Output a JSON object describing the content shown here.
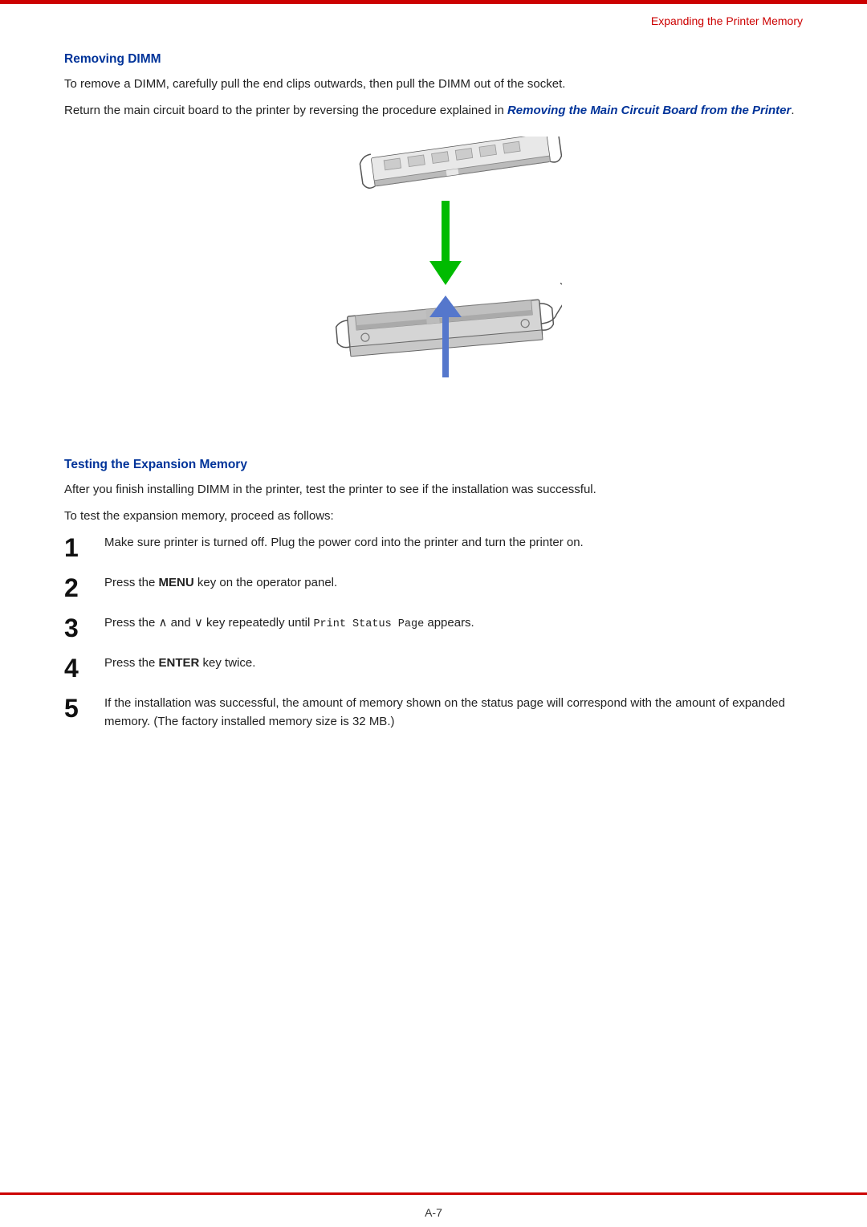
{
  "header": {
    "top_link": "Expanding the Printer Memory"
  },
  "section1": {
    "title": "Removing DIMM",
    "para1": "To remove a DIMM, carefully pull the end clips outwards, then pull the DIMM out of the socket.",
    "para2_start": "Return the main circuit board to the printer by reversing the procedure explained in ",
    "para2_link": "Removing the Main Circuit Board from the Printer",
    "para2_end": "."
  },
  "section2": {
    "title": "Testing the Expansion Memory",
    "para1": "After you finish installing DIMM in the printer, test the printer to see if the installation was successful.",
    "para2": "To test the expansion memory, proceed as follows:",
    "steps": [
      {
        "number": "1",
        "text_parts": [
          {
            "type": "plain",
            "text": "Make sure printer is turned off. Plug the power cord into the printer and turn the printer on."
          }
        ]
      },
      {
        "number": "2",
        "text_parts": [
          {
            "type": "plain",
            "text": "Press the "
          },
          {
            "type": "bold",
            "text": "MENU"
          },
          {
            "type": "plain",
            "text": " key on the operator panel."
          }
        ]
      },
      {
        "number": "3",
        "text_parts": [
          {
            "type": "plain",
            "text": "Press the ∧ and ∨ key repeatedly until "
          },
          {
            "type": "code",
            "text": "Print Status Page"
          },
          {
            "type": "plain",
            "text": " appears."
          }
        ]
      },
      {
        "number": "4",
        "text_parts": [
          {
            "type": "plain",
            "text": "Press the "
          },
          {
            "type": "bold",
            "text": "ENTER"
          },
          {
            "type": "plain",
            "text": " key twice."
          }
        ]
      },
      {
        "number": "5",
        "text_parts": [
          {
            "type": "plain",
            "text": "If the installation was successful, the amount of memory shown on the status page will correspond with the amount of expanded memory. (The factory installed memory size is 32 MB.)"
          }
        ]
      }
    ]
  },
  "footer": {
    "page": "A-7"
  },
  "colors": {
    "accent": "#cc0000",
    "blue": "#003399",
    "green": "#00aa00"
  }
}
